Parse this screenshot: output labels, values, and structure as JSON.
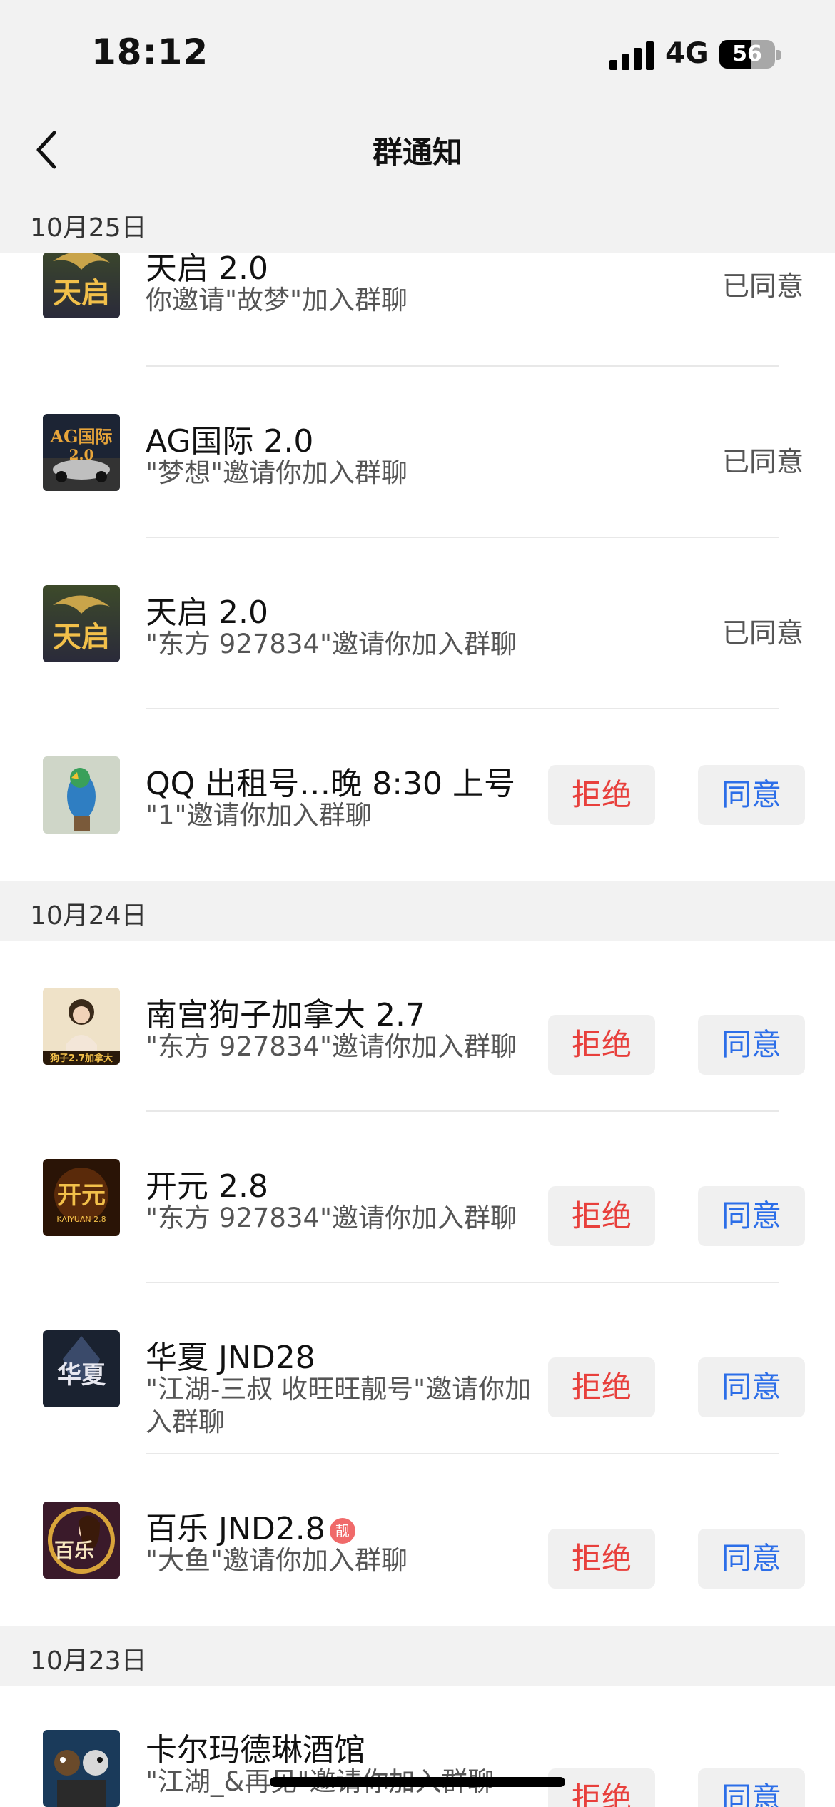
{
  "status_bar": {
    "time": "18:12",
    "network": "4G",
    "battery_level": "56"
  },
  "nav": {
    "title": "群通知"
  },
  "sections": [
    {
      "date": "10月25日"
    },
    {
      "date": "10月24日"
    },
    {
      "date": "10月23日"
    }
  ],
  "items": [
    {
      "name": "天启 2.0",
      "desc": "你邀请\"故梦\"加入群聊",
      "status": "已同意"
    },
    {
      "name": "AG国际 2.0",
      "desc": "\"梦想\"邀请你加入群聊",
      "status": "已同意"
    },
    {
      "name": "天启 2.0",
      "desc": "\"东方 927834\"邀请你加入群聊",
      "status": "已同意"
    },
    {
      "name": "QQ 出租号…晚 8:30 上号",
      "desc": "\"1\"邀请你加入群聊",
      "reject": "拒绝",
      "accept": "同意"
    },
    {
      "name": "南宫狗子加拿大 2.7",
      "desc": "\"东方 927834\"邀请你加入群聊",
      "reject": "拒绝",
      "accept": "同意"
    },
    {
      "name": "开元 2.8",
      "desc": "\"东方 927834\"邀请你加入群聊",
      "reject": "拒绝",
      "accept": "同意"
    },
    {
      "name": "华夏 JND28",
      "desc": "\"江湖-三叔 收旺旺靓号\"邀请你加入群聊",
      "reject": "拒绝",
      "accept": "同意"
    },
    {
      "name": "百乐 JND2.8",
      "badge": "靓",
      "desc": "\"大鱼\"邀请你加入群聊",
      "reject": "拒绝",
      "accept": "同意"
    },
    {
      "name": "卡尔玛德琳酒馆",
      "desc": "\"江湖_&再见\"邀请你加入群聊",
      "reject": "拒绝",
      "accept": "同意"
    }
  ],
  "avatar_labels": {
    "tianqi": "天启",
    "ag": "AG国际",
    "ag_sub": "2.0",
    "nangong": "狗子2.7加拿大",
    "kaiyuan": "开元",
    "kaiyuan_sub": "KAIYUAN 2.8",
    "huaxia": "华夏",
    "baile": "百乐"
  },
  "colors": {
    "reject": "#e8403c",
    "accept": "#2c6ee8",
    "section_bg": "#f2f2f2",
    "badge": "#f06a6a"
  }
}
